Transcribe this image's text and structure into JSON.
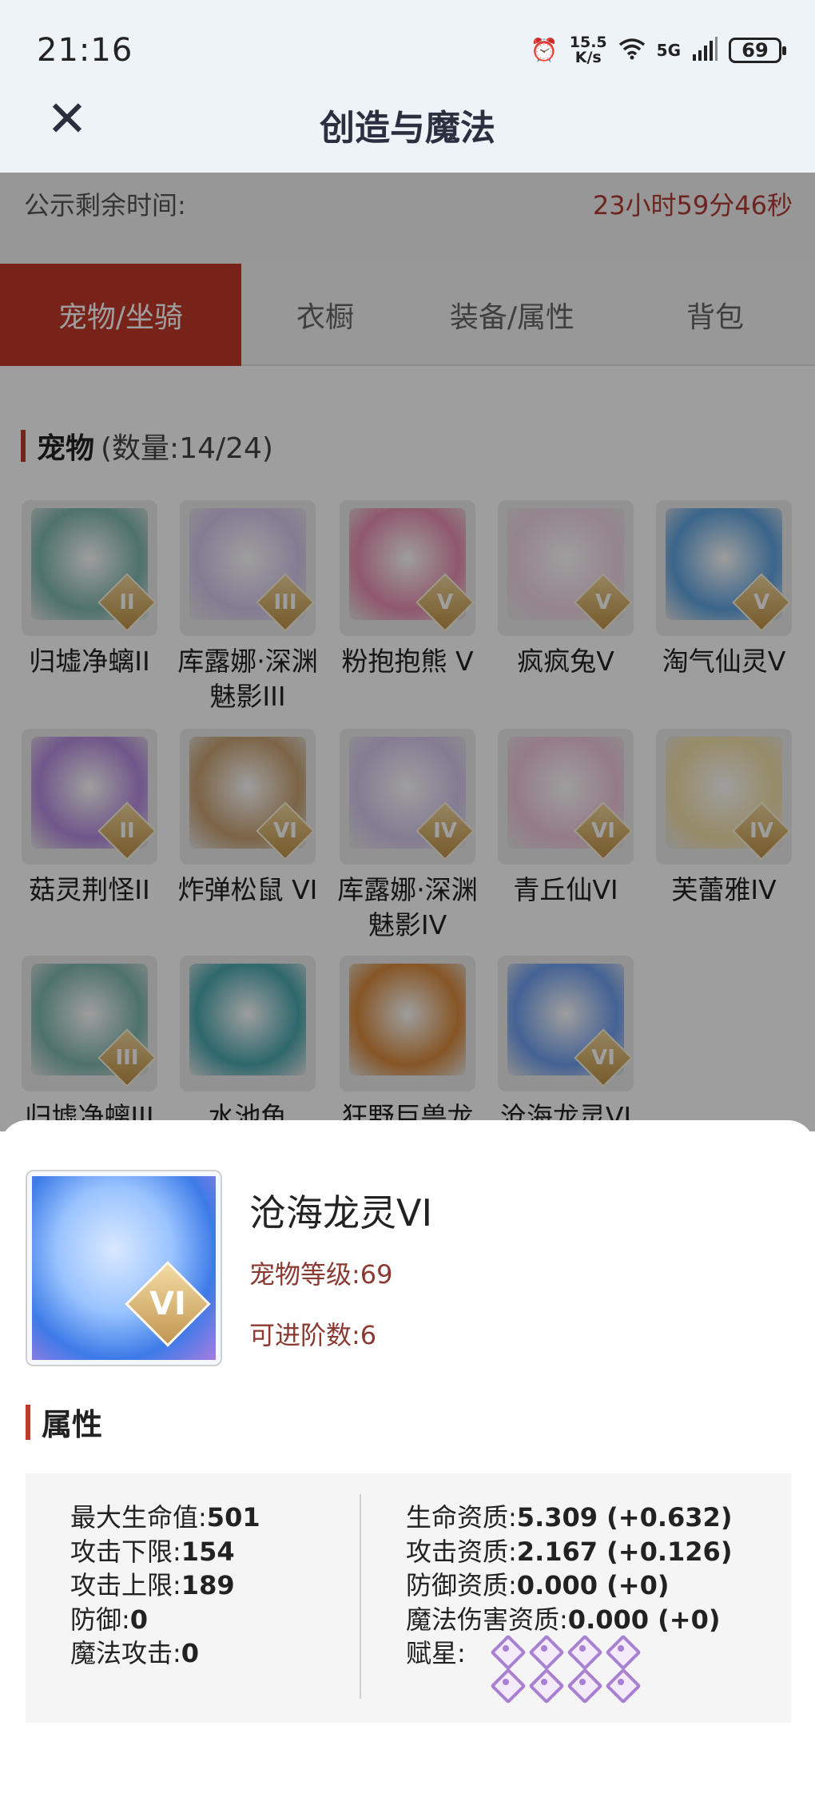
{
  "status": {
    "time": "21:16",
    "speed_value": "15.5",
    "speed_unit": "K/s",
    "network": "5G",
    "battery": "69"
  },
  "header": {
    "title": "创造与魔法"
  },
  "notice": {
    "label": "公示剩余时间:",
    "remaining": "23小时59分46秒"
  },
  "tabs": [
    {
      "label": "宠物/坐骑",
      "active": true
    },
    {
      "label": "衣橱",
      "active": false
    },
    {
      "label": "装备/属性",
      "active": false
    },
    {
      "label": "背包",
      "active": false
    }
  ],
  "pets_section": {
    "title": "宠物",
    "count": "(数量:14/24)"
  },
  "pets": [
    {
      "name": "归墟净螭II",
      "rank": "II",
      "color": "#7fb8b0"
    },
    {
      "name": "库露娜·深渊魅影III",
      "rank": "III",
      "color": "#d7c9ee"
    },
    {
      "name": "粉抱抱熊 V",
      "rank": "V",
      "color": "#e98fb0"
    },
    {
      "name": "疯疯兔V",
      "rank": "V",
      "color": "#f1d7e6"
    },
    {
      "name": "淘气仙灵V",
      "rank": "V",
      "color": "#5fa3e0"
    },
    {
      "name": "菇灵荆怪II",
      "rank": "II",
      "color": "#b58be0"
    },
    {
      "name": "炸弹松鼠 VI",
      "rank": "VI",
      "color": "#c9a273"
    },
    {
      "name": "库露娜·深渊魅影IV",
      "rank": "IV",
      "color": "#d7c9ee"
    },
    {
      "name": "青丘仙VI",
      "rank": "VI",
      "color": "#f0c8dc"
    },
    {
      "name": "芙蕾雅IV",
      "rank": "IV",
      "color": "#f4e2a8"
    },
    {
      "name": "归墟净螭III",
      "rank": "III",
      "color": "#7fb8b0"
    },
    {
      "name": "水池龟",
      "rank": "",
      "color": "#4aa8b0"
    },
    {
      "name": "狂野巨兽龙",
      "rank": "",
      "color": "#d98a3d"
    },
    {
      "name": "沧海龙灵VI",
      "rank": "VI",
      "color": "#6f9ff0"
    }
  ],
  "detail": {
    "name": "沧海龙灵VI",
    "rank": "VI",
    "level_text": "宠物等级:69",
    "stage_text": "可进阶数:6",
    "attr_title": "属性",
    "left": [
      {
        "label": "最大生命值:",
        "value": "501"
      },
      {
        "label": "攻击下限:",
        "value": "154"
      },
      {
        "label": "攻击上限:",
        "value": "189"
      },
      {
        "label": "防御:",
        "value": "0"
      },
      {
        "label": "魔法攻击:",
        "value": "0"
      }
    ],
    "right": [
      {
        "label": "生命资质:",
        "value": "5.309 (+0.632)"
      },
      {
        "label": "攻击资质:",
        "value": "2.167 (+0.126)"
      },
      {
        "label": "防御资质:",
        "value": "0.000 (+0)"
      },
      {
        "label": "魔法伤害资质:",
        "value": "0.000 (+0)"
      }
    ],
    "stars_label": "赋星:",
    "stars": 8
  }
}
